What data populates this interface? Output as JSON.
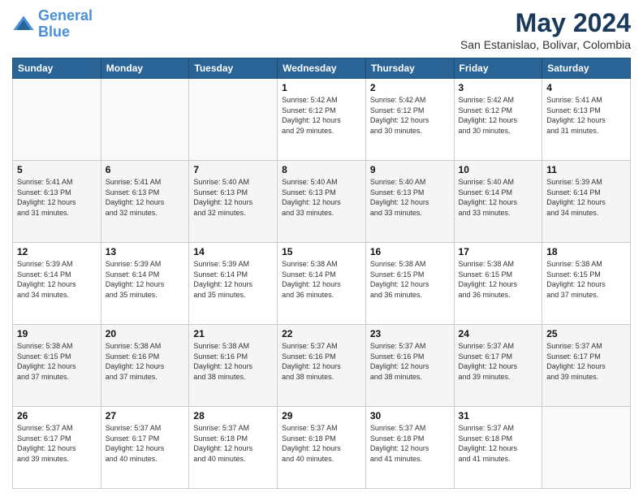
{
  "logo": {
    "line1": "General",
    "line2": "Blue"
  },
  "title": "May 2024",
  "subtitle": "San Estanislao, Bolivar, Colombia",
  "days_of_week": [
    "Sunday",
    "Monday",
    "Tuesday",
    "Wednesday",
    "Thursday",
    "Friday",
    "Saturday"
  ],
  "weeks": [
    [
      {
        "day": "",
        "info": ""
      },
      {
        "day": "",
        "info": ""
      },
      {
        "day": "",
        "info": ""
      },
      {
        "day": "1",
        "info": "Sunrise: 5:42 AM\nSunset: 6:12 PM\nDaylight: 12 hours\nand 29 minutes."
      },
      {
        "day": "2",
        "info": "Sunrise: 5:42 AM\nSunset: 6:12 PM\nDaylight: 12 hours\nand 30 minutes."
      },
      {
        "day": "3",
        "info": "Sunrise: 5:42 AM\nSunset: 6:12 PM\nDaylight: 12 hours\nand 30 minutes."
      },
      {
        "day": "4",
        "info": "Sunrise: 5:41 AM\nSunset: 6:13 PM\nDaylight: 12 hours\nand 31 minutes."
      }
    ],
    [
      {
        "day": "5",
        "info": "Sunrise: 5:41 AM\nSunset: 6:13 PM\nDaylight: 12 hours\nand 31 minutes."
      },
      {
        "day": "6",
        "info": "Sunrise: 5:41 AM\nSunset: 6:13 PM\nDaylight: 12 hours\nand 32 minutes."
      },
      {
        "day": "7",
        "info": "Sunrise: 5:40 AM\nSunset: 6:13 PM\nDaylight: 12 hours\nand 32 minutes."
      },
      {
        "day": "8",
        "info": "Sunrise: 5:40 AM\nSunset: 6:13 PM\nDaylight: 12 hours\nand 33 minutes."
      },
      {
        "day": "9",
        "info": "Sunrise: 5:40 AM\nSunset: 6:13 PM\nDaylight: 12 hours\nand 33 minutes."
      },
      {
        "day": "10",
        "info": "Sunrise: 5:40 AM\nSunset: 6:14 PM\nDaylight: 12 hours\nand 33 minutes."
      },
      {
        "day": "11",
        "info": "Sunrise: 5:39 AM\nSunset: 6:14 PM\nDaylight: 12 hours\nand 34 minutes."
      }
    ],
    [
      {
        "day": "12",
        "info": "Sunrise: 5:39 AM\nSunset: 6:14 PM\nDaylight: 12 hours\nand 34 minutes."
      },
      {
        "day": "13",
        "info": "Sunrise: 5:39 AM\nSunset: 6:14 PM\nDaylight: 12 hours\nand 35 minutes."
      },
      {
        "day": "14",
        "info": "Sunrise: 5:39 AM\nSunset: 6:14 PM\nDaylight: 12 hours\nand 35 minutes."
      },
      {
        "day": "15",
        "info": "Sunrise: 5:38 AM\nSunset: 6:14 PM\nDaylight: 12 hours\nand 36 minutes."
      },
      {
        "day": "16",
        "info": "Sunrise: 5:38 AM\nSunset: 6:15 PM\nDaylight: 12 hours\nand 36 minutes."
      },
      {
        "day": "17",
        "info": "Sunrise: 5:38 AM\nSunset: 6:15 PM\nDaylight: 12 hours\nand 36 minutes."
      },
      {
        "day": "18",
        "info": "Sunrise: 5:38 AM\nSunset: 6:15 PM\nDaylight: 12 hours\nand 37 minutes."
      }
    ],
    [
      {
        "day": "19",
        "info": "Sunrise: 5:38 AM\nSunset: 6:15 PM\nDaylight: 12 hours\nand 37 minutes."
      },
      {
        "day": "20",
        "info": "Sunrise: 5:38 AM\nSunset: 6:16 PM\nDaylight: 12 hours\nand 37 minutes."
      },
      {
        "day": "21",
        "info": "Sunrise: 5:38 AM\nSunset: 6:16 PM\nDaylight: 12 hours\nand 38 minutes."
      },
      {
        "day": "22",
        "info": "Sunrise: 5:37 AM\nSunset: 6:16 PM\nDaylight: 12 hours\nand 38 minutes."
      },
      {
        "day": "23",
        "info": "Sunrise: 5:37 AM\nSunset: 6:16 PM\nDaylight: 12 hours\nand 38 minutes."
      },
      {
        "day": "24",
        "info": "Sunrise: 5:37 AM\nSunset: 6:17 PM\nDaylight: 12 hours\nand 39 minutes."
      },
      {
        "day": "25",
        "info": "Sunrise: 5:37 AM\nSunset: 6:17 PM\nDaylight: 12 hours\nand 39 minutes."
      }
    ],
    [
      {
        "day": "26",
        "info": "Sunrise: 5:37 AM\nSunset: 6:17 PM\nDaylight: 12 hours\nand 39 minutes."
      },
      {
        "day": "27",
        "info": "Sunrise: 5:37 AM\nSunset: 6:17 PM\nDaylight: 12 hours\nand 40 minutes."
      },
      {
        "day": "28",
        "info": "Sunrise: 5:37 AM\nSunset: 6:18 PM\nDaylight: 12 hours\nand 40 minutes."
      },
      {
        "day": "29",
        "info": "Sunrise: 5:37 AM\nSunset: 6:18 PM\nDaylight: 12 hours\nand 40 minutes."
      },
      {
        "day": "30",
        "info": "Sunrise: 5:37 AM\nSunset: 6:18 PM\nDaylight: 12 hours\nand 41 minutes."
      },
      {
        "day": "31",
        "info": "Sunrise: 5:37 AM\nSunset: 6:18 PM\nDaylight: 12 hours\nand 41 minutes."
      },
      {
        "day": "",
        "info": ""
      }
    ]
  ]
}
